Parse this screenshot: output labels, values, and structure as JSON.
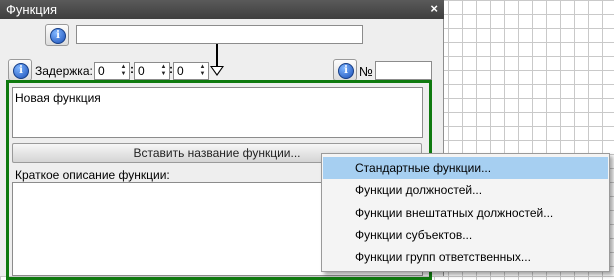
{
  "window": {
    "title": "Функция",
    "close": "×"
  },
  "header": {
    "name_value": ""
  },
  "delay": {
    "label": "Задержка:",
    "hours": "0",
    "minutes": "0",
    "seconds": "0",
    "sep": ":"
  },
  "number": {
    "label": "№",
    "value": ""
  },
  "function": {
    "name": "Новая функция"
  },
  "insert_button": "Вставить название функции...",
  "description": {
    "label": "Краткое описание функции:",
    "value": ""
  },
  "info_glyph": "i",
  "menu": {
    "items": [
      {
        "label": "Стандартные функции...",
        "active": true
      },
      {
        "label": "Функции должностей...",
        "active": false
      },
      {
        "label": "Функции внештатных должностей...",
        "active": false
      },
      {
        "label": "Функции субъектов...",
        "active": false
      },
      {
        "label": "Функции групп ответственных...",
        "active": false
      }
    ]
  },
  "icons": {
    "info": "info-icon",
    "close": "close-icon",
    "spin_up": "chevron-up-icon",
    "spin_down": "chevron-down-icon",
    "flow": "flow-arrow-icon"
  }
}
